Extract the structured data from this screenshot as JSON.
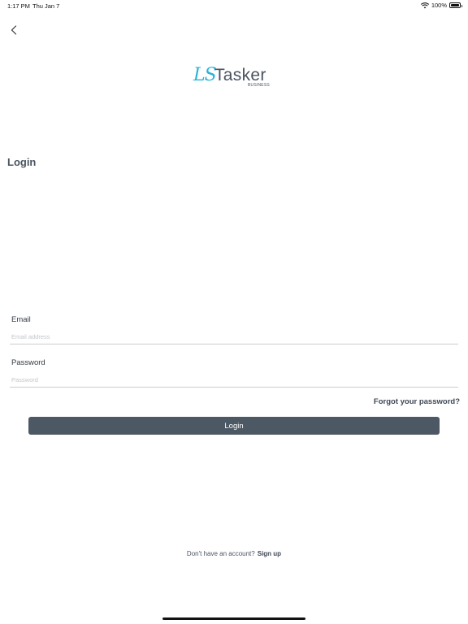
{
  "status_bar": {
    "time": "1:17 PM",
    "date": "Thu Jan 7",
    "battery": "100%",
    "icons": [
      "wifi-icon",
      "battery-icon"
    ]
  },
  "nav": {
    "back_icon": "chevron-left-icon"
  },
  "logo": {
    "mark": "LS",
    "word": "Tasker",
    "sub": "BUSINESS",
    "brand_color": "#29b3d6"
  },
  "page": {
    "title": "Login"
  },
  "form": {
    "email_label": "Email",
    "email_placeholder": "Email address",
    "email_value": "",
    "password_label": "Password",
    "password_placeholder": "Password",
    "password_value": "",
    "forgot_label": "Forgot your password?",
    "login_label": "Login",
    "button_color": "#4d5865"
  },
  "footer": {
    "prompt": "Don't have an account?",
    "signup_label": "Sign up"
  }
}
